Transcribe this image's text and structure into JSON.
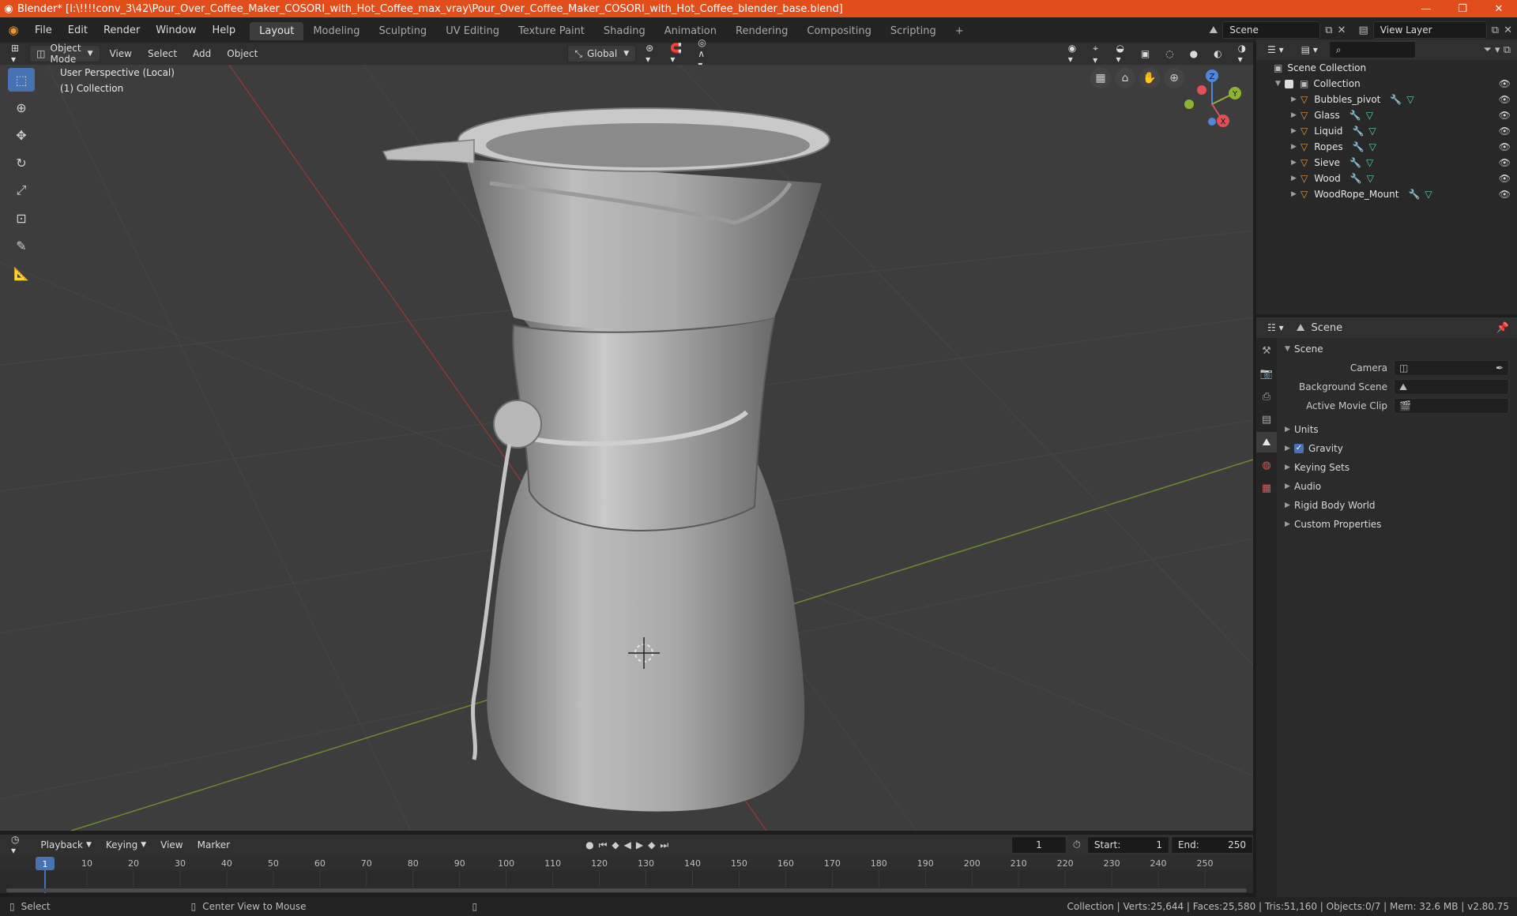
{
  "title_bar": {
    "title": "Blender* [I:\\!!!!conv_3\\42\\Pour_Over_Coffee_Maker_COSORI_with_Hot_Coffee_max_vray\\Pour_Over_Coffee_Maker_COSORI_with_Hot_Coffee_blender_base.blend]",
    "minimize": "—",
    "restore": "❐",
    "close": "✕"
  },
  "menu": {
    "items": [
      "File",
      "Edit",
      "Render",
      "Window",
      "Help"
    ]
  },
  "workspaces": {
    "tabs": [
      "Layout",
      "Modeling",
      "Sculpting",
      "UV Editing",
      "Texture Paint",
      "Shading",
      "Animation",
      "Rendering",
      "Compositing",
      "Scripting"
    ],
    "active": "Layout",
    "add": "+"
  },
  "top_right": {
    "scene": "Scene",
    "view_layer": "View Layer"
  },
  "viewport_header": {
    "mode": "Object Mode",
    "menus": [
      "View",
      "Select",
      "Add",
      "Object"
    ],
    "orientation": "Global"
  },
  "viewport": {
    "perspective_label": "User Perspective (Local)",
    "collection_label": "(1) Collection",
    "gizmo": {
      "x": "X",
      "y": "Y",
      "z": "Z"
    }
  },
  "outliner": {
    "root": "Scene Collection",
    "collection": "Collection",
    "objects": [
      "Bubbles_pivot",
      "Glass",
      "Liquid",
      "Ropes",
      "Sieve",
      "Wood",
      "WoodRope_Mount"
    ]
  },
  "properties": {
    "header": "Scene",
    "section": "Scene",
    "fields": [
      {
        "label": "Camera"
      },
      {
        "label": "Background Scene"
      },
      {
        "label": "Active Movie Clip"
      }
    ],
    "panels": [
      "Units",
      "Gravity",
      "Keying Sets",
      "Audio",
      "Rigid Body World",
      "Custom Properties"
    ],
    "gravity_checked": true
  },
  "timeline": {
    "menus": [
      "Playback",
      "Keying",
      "View",
      "Marker"
    ],
    "current_frame": "1",
    "start_label": "Start:",
    "start": "1",
    "end_label": "End:",
    "end": "250",
    "ticks": [
      "1",
      "10",
      "20",
      "30",
      "40",
      "50",
      "60",
      "70",
      "80",
      "90",
      "100",
      "110",
      "120",
      "130",
      "140",
      "150",
      "160",
      "170",
      "180",
      "190",
      "200",
      "210",
      "220",
      "230",
      "240",
      "250"
    ]
  },
  "status_bar": {
    "left": "Select",
    "middle": "Center View to Mouse",
    "right": "Collection | Verts:25,644 | Faces:25,580 | Tris:51,160 | Objects:0/7 | Mem: 32.6 MB | v2.80.75"
  },
  "colors": {
    "title_bar": "#e24e1b",
    "active_tool": "#4772b3",
    "object_icon": "#e8963a",
    "modifier_icon": "#6fa3ec",
    "mesh_icon": "#5cd2b3",
    "axis_x": "#e05056",
    "axis_y": "#8cb332",
    "axis_z": "#4d89d8"
  }
}
